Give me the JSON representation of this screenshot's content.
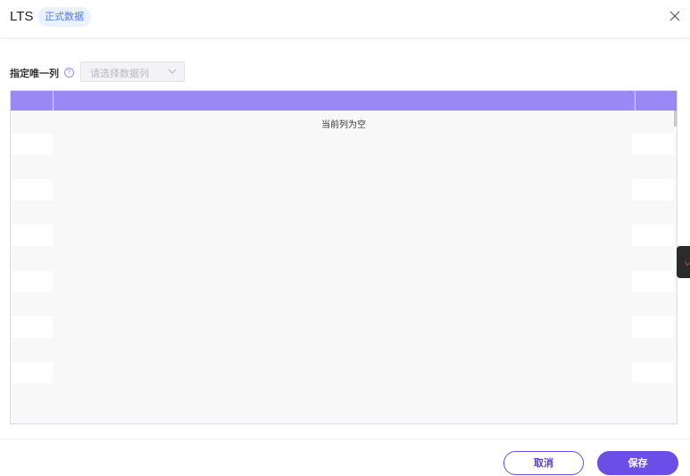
{
  "header": {
    "title": "LTS",
    "badge": "正式数据",
    "close_icon": "close-icon"
  },
  "toolbar": {
    "label": "指定唯一列",
    "help_icon": "help-icon",
    "help_glyph": "?",
    "select_placeholder": "请选择数据列",
    "select_icon": "chevron-down-icon"
  },
  "table": {
    "empty_text": "当前列为空",
    "header_color": "#9a88f5"
  },
  "footer": {
    "cancel_label": "取消",
    "save_label": "保存"
  },
  "colors": {
    "accent": "#6b4ee8",
    "badge_text": "#4a7cf0",
    "badge_bg": "#eaf1ff"
  }
}
